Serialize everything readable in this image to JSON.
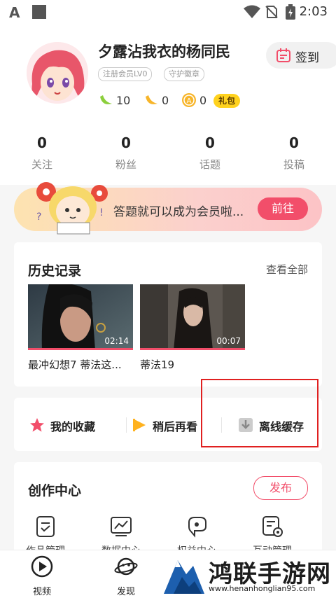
{
  "status_bar": {
    "time": "2:03"
  },
  "profile": {
    "nickname": "夕露沾我衣的杨同民",
    "signin_label": "签到",
    "badges": [
      "注册会员LV0",
      "守护徽章"
    ],
    "coins": [
      {
        "icon": "banana-icon",
        "value": "10"
      },
      {
        "icon": "gold-banana-icon",
        "value": "0"
      },
      {
        "icon": "a-coin-icon",
        "value": "0"
      }
    ],
    "gift_label": "礼包",
    "stats": [
      {
        "value": "0",
        "label": "关注"
      },
      {
        "value": "0",
        "label": "粉丝"
      },
      {
        "value": "0",
        "label": "话题"
      },
      {
        "value": "0",
        "label": "投稿"
      }
    ]
  },
  "banner": {
    "text": "答题就可以成为会员啦...",
    "button": "前往"
  },
  "history": {
    "title": "历史记录",
    "more": "查看全部",
    "videos": [
      {
        "title": "最冲幻想7 蒂法这...",
        "duration": "02:14"
      },
      {
        "title": "蒂法19",
        "duration": "00:07"
      }
    ]
  },
  "shortcuts": [
    {
      "label": "我的收藏",
      "icon": "star-icon",
      "color": "#f24e6a"
    },
    {
      "label": "稍后再看",
      "icon": "play-clock-icon",
      "color": "#ffb21f"
    },
    {
      "label": "离线缓存",
      "icon": "download-icon",
      "color": "#aaaaaa"
    }
  ],
  "create_center": {
    "title": "创作中心",
    "publish": "发布",
    "tools": [
      "作品管理",
      "数据中心",
      "权益中心",
      "互动管理"
    ]
  },
  "tabbar": [
    {
      "label": "视频",
      "icon": "video-tab-icon"
    },
    {
      "label": "发现",
      "icon": "planet-icon"
    }
  ],
  "watermark": {
    "text": "鸿联手游网",
    "url": "www.henanhonglian95.com"
  },
  "colors": {
    "accent": "#f24e6a",
    "gold": "#ffd21e"
  }
}
